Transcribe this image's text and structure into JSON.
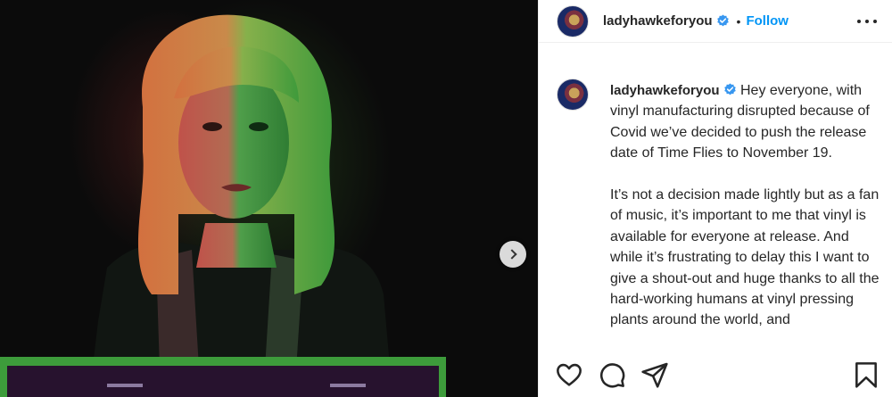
{
  "post": {
    "username": "ladyhawkeforyou",
    "follow_label": "Follow",
    "separator": "•",
    "caption_paragraphs": [
      "Hey everyone, with vinyl manufacturing disrupted because of Covid we’ve decided to push the release date of Time Flies to November 19.",
      "It’s not a decision made lightly but as a fan of music, it’s important to me that vinyl is available for everyone at release. And while it’s frustrating to delay this I want to give a shout-out and huge thanks to all the hard-working humans at vinyl pressing plants around the world, and"
    ]
  },
  "icons": {
    "verified": "verified-badge-icon",
    "more": "more-options-icon",
    "next": "chevron-right-icon",
    "like": "heart-icon",
    "comment": "comment-icon",
    "share": "paper-plane-icon",
    "save": "bookmark-icon"
  },
  "colors": {
    "accent": "#0095f6",
    "text": "#262626",
    "border": "#efefef"
  }
}
